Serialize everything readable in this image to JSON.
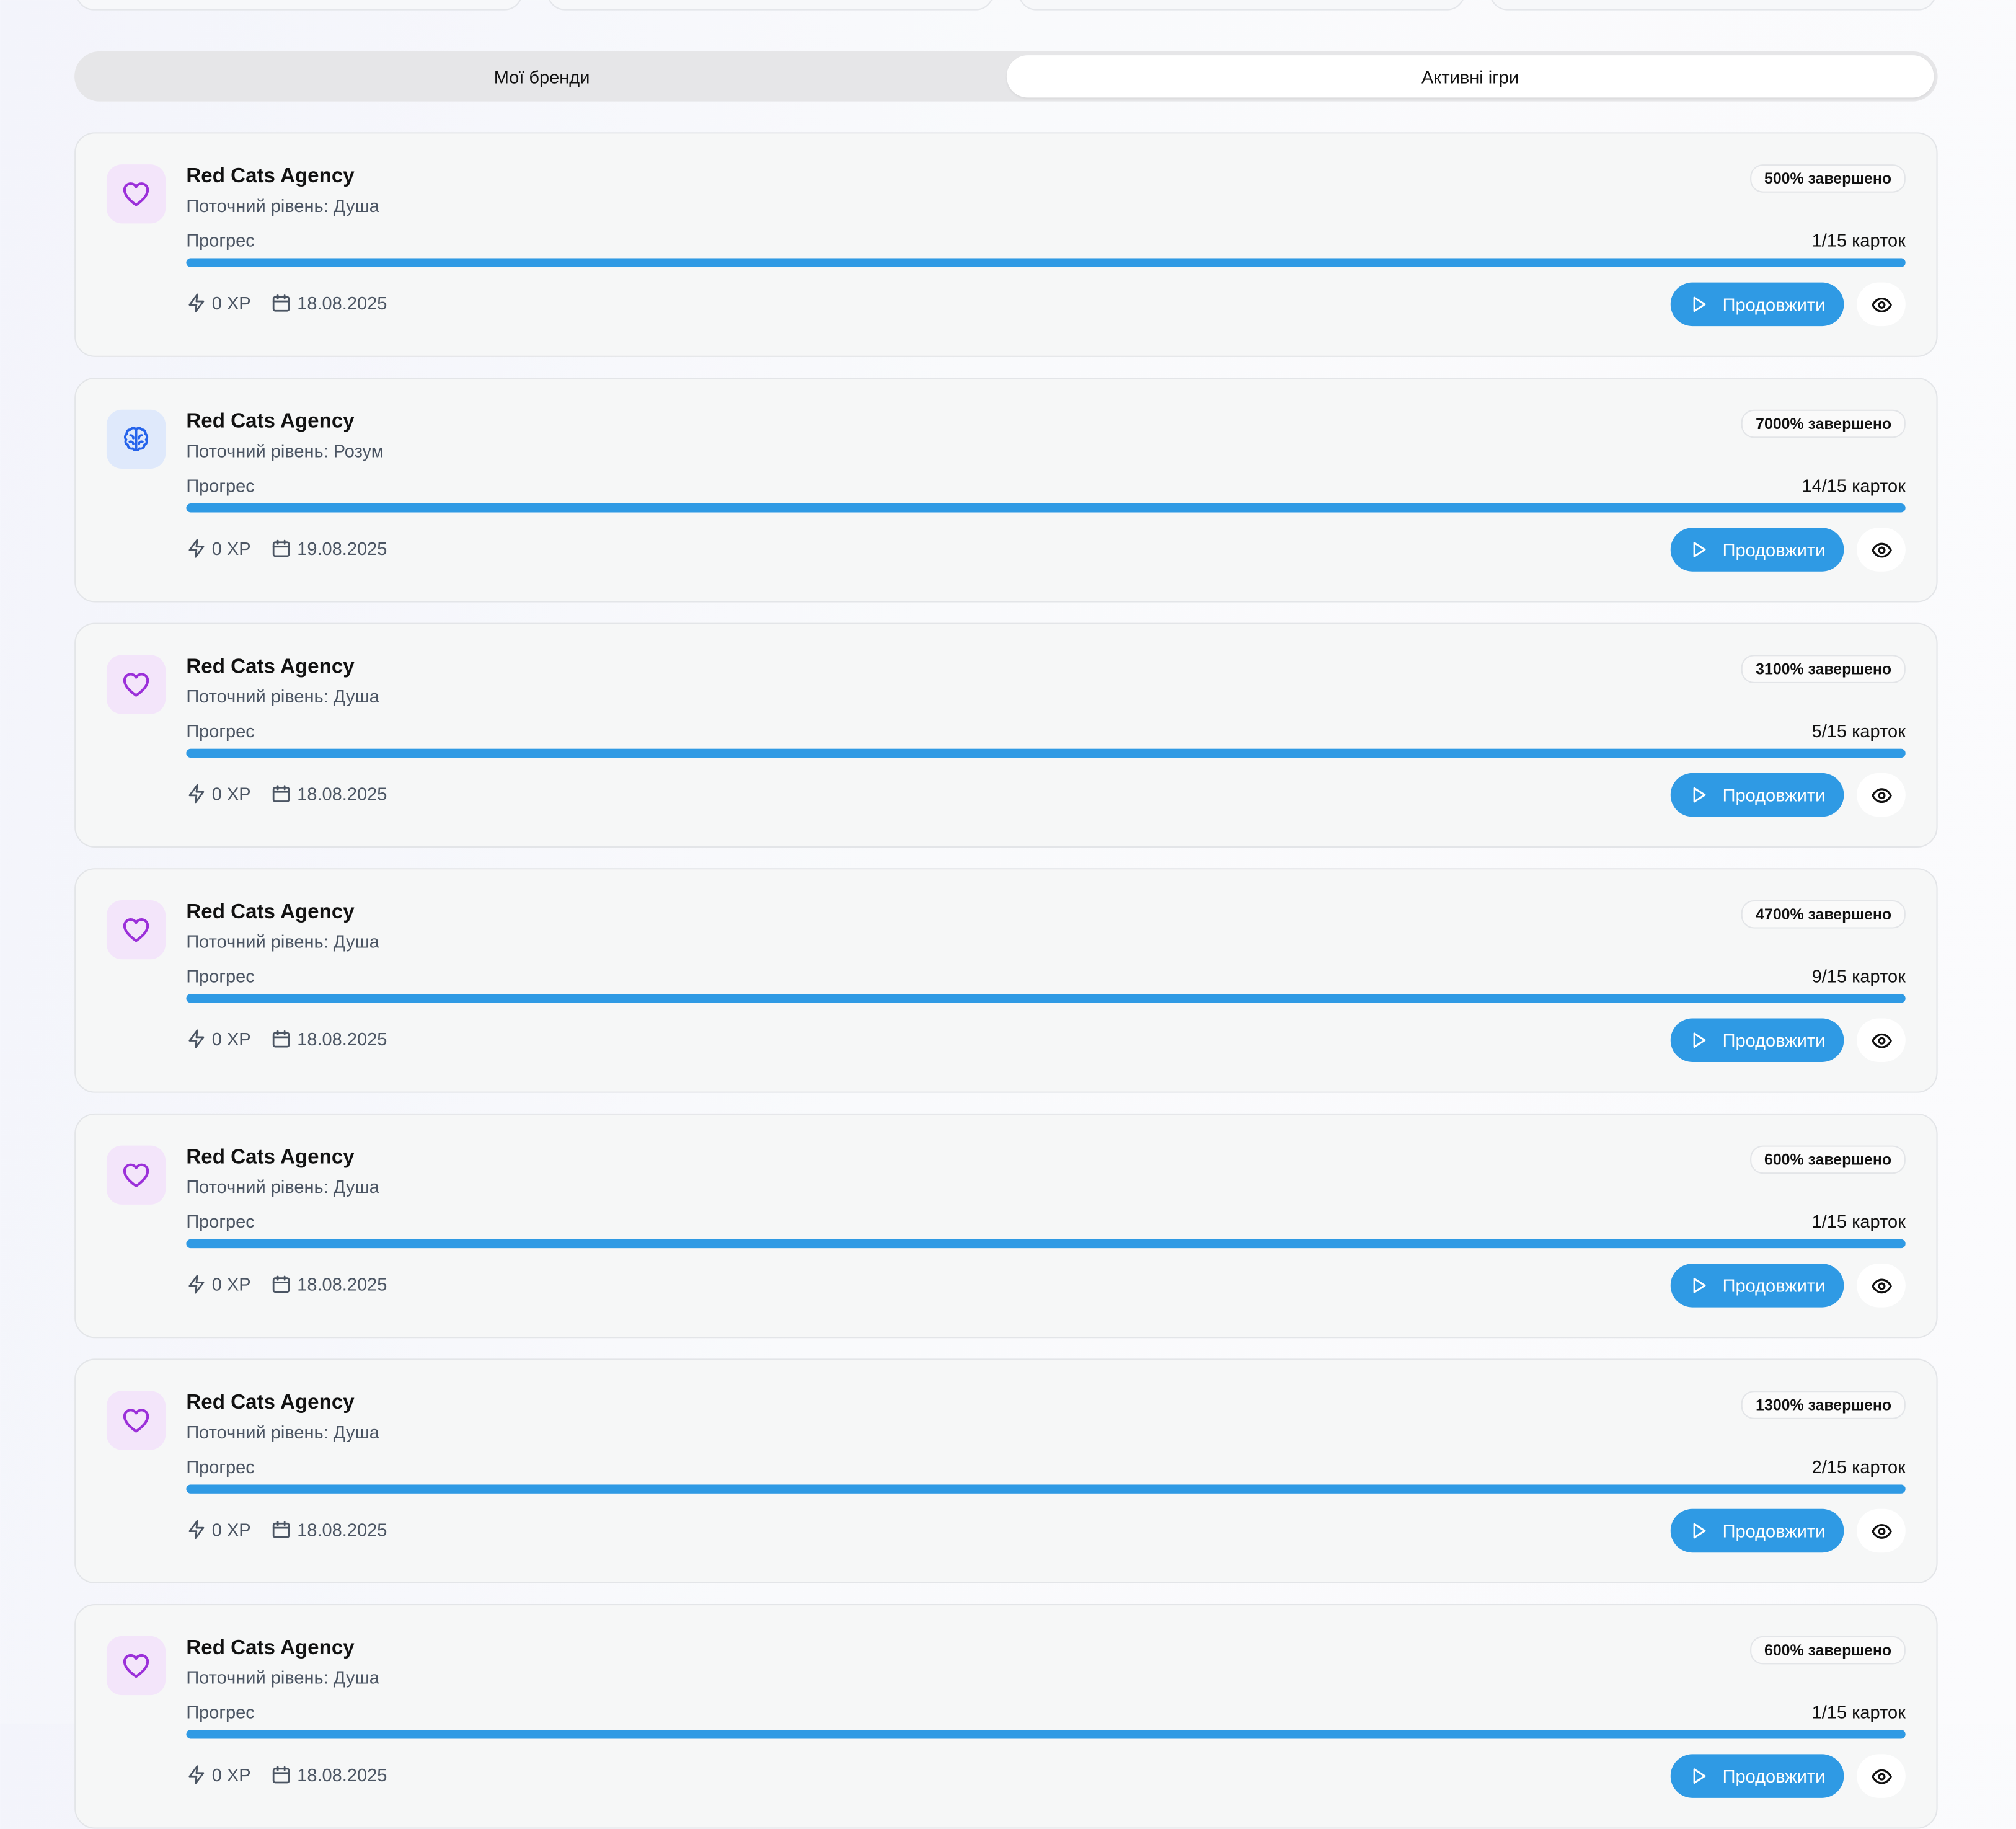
{
  "tabs": {
    "my_brands": "Мої бренди",
    "active_games": "Активні ігри",
    "active": "active_games"
  },
  "labels": {
    "progress": "Прогрес",
    "continue": "Продовжити"
  },
  "colors": {
    "accent": "#2f9ae4",
    "soul_icon": "#9b30d9",
    "mind_icon": "#2563eb"
  },
  "games": [
    {
      "brand": "Red Cats Agency",
      "level": "Поточний рівень: Душа",
      "level_icon": "heart-icon",
      "completed": "500% завершено",
      "cards": "1/15 карток",
      "xp": "0 XP",
      "date": "18.08.2025",
      "progress": 1.0
    },
    {
      "brand": "Red Cats Agency",
      "level": "Поточний рівень: Розум",
      "level_icon": "brain-icon",
      "completed": "7000% завершено",
      "cards": "14/15 карток",
      "xp": "0 XP",
      "date": "19.08.2025",
      "progress": 1.0
    },
    {
      "brand": "Red Cats Agency",
      "level": "Поточний рівень: Душа",
      "level_icon": "heart-icon",
      "completed": "3100% завершено",
      "cards": "5/15 карток",
      "xp": "0 XP",
      "date": "18.08.2025",
      "progress": 1.0
    },
    {
      "brand": "Red Cats Agency",
      "level": "Поточний рівень: Душа",
      "level_icon": "heart-icon",
      "completed": "4700% завершено",
      "cards": "9/15 карток",
      "xp": "0 XP",
      "date": "18.08.2025",
      "progress": 1.0
    },
    {
      "brand": "Red Cats Agency",
      "level": "Поточний рівень: Душа",
      "level_icon": "heart-icon",
      "completed": "600% завершено",
      "cards": "1/15 карток",
      "xp": "0 XP",
      "date": "18.08.2025",
      "progress": 1.0
    },
    {
      "brand": "Red Cats Agency",
      "level": "Поточний рівень: Душа",
      "level_icon": "heart-icon",
      "completed": "1300% завершено",
      "cards": "2/15 карток",
      "xp": "0 XP",
      "date": "18.08.2025",
      "progress": 1.0
    },
    {
      "brand": "Red Cats Agency",
      "level": "Поточний рівень: Душа",
      "level_icon": "heart-icon",
      "completed": "600% завершено",
      "cards": "1/15 карток",
      "xp": "0 XP",
      "date": "18.08.2025",
      "progress": 1.0
    }
  ]
}
